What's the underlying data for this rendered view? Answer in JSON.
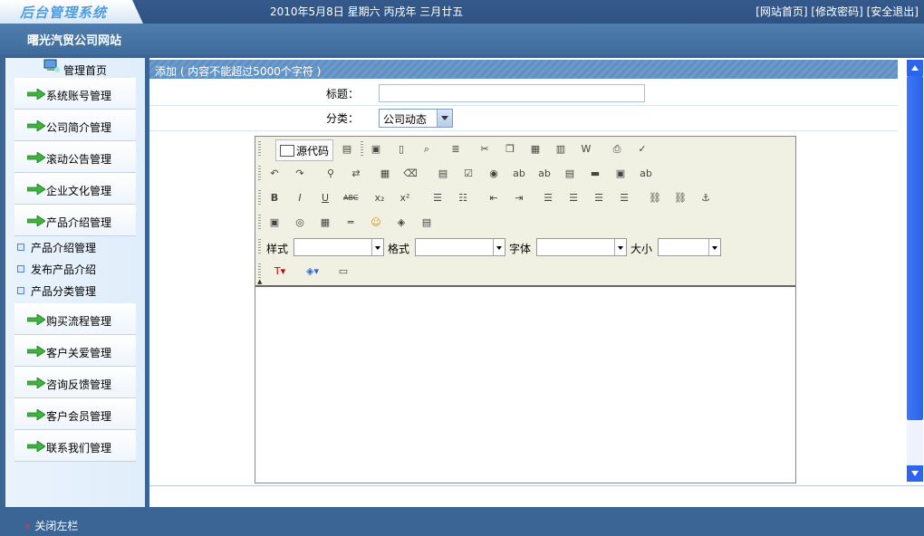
{
  "header": {
    "logo_text": "后台管理系统",
    "date": "2010年5月8日  星期六  丙戌年  三月廿五",
    "links": [
      "[网站首页]",
      "[修改密码]",
      "[安全退出]"
    ],
    "site_name": "曙光汽贸公司网站"
  },
  "sidebar": {
    "home": "管理首页",
    "items": [
      {
        "label": "系统账号管理"
      },
      {
        "label": "公司简介管理"
      },
      {
        "label": "滚动公告管理"
      },
      {
        "label": "企业文化管理"
      },
      {
        "label": "产品介绍管理"
      }
    ],
    "subitems": [
      {
        "label": "产品介绍管理"
      },
      {
        "label": "发布产品介绍"
      },
      {
        "label": "产品分类管理"
      }
    ],
    "items_after": [
      {
        "label": "购买流程管理"
      },
      {
        "label": "客户关爱管理"
      },
      {
        "label": "咨询反馈管理"
      },
      {
        "label": "客户会员管理"
      },
      {
        "label": "联系我们管理"
      }
    ]
  },
  "form": {
    "panel_title": "添加  ( 内容不能超过5000个字符 )",
    "title_label": "标题：",
    "title_value": "",
    "category_label": "分类：",
    "category_value": "公司动态"
  },
  "editor": {
    "source_button": "源代码",
    "style_label": "样式",
    "format_label": "格式",
    "font_label": "字体",
    "size_label": "大小"
  },
  "footer": {
    "close_left": "关闭左栏"
  },
  "colors": {
    "header_bg": "#2e5383",
    "panel_title_bg": "#5e90c2",
    "scrollbar": "#2c64f0"
  }
}
